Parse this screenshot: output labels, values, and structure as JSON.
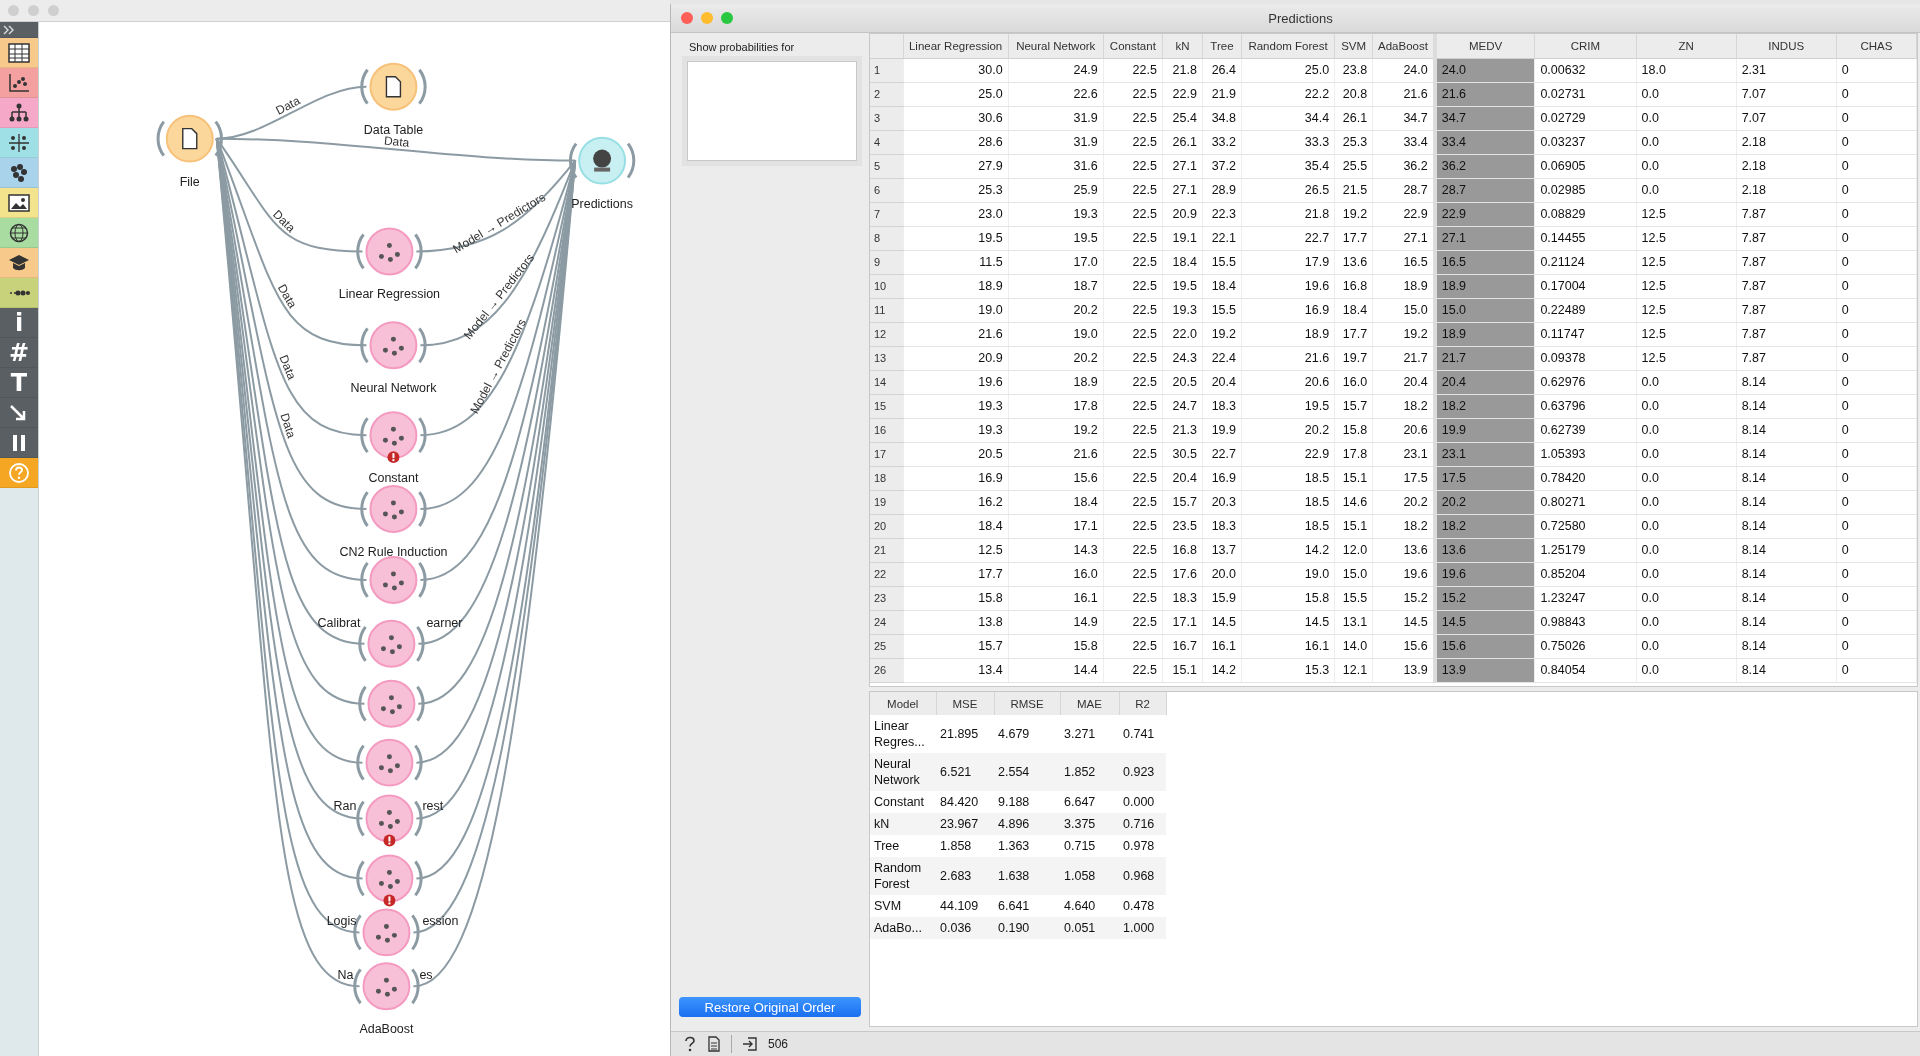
{
  "toolbar": [
    {
      "kind": "expand",
      "color": "#5a5f63"
    },
    {
      "kind": "table",
      "color": "#f7c98a"
    },
    {
      "kind": "scatter",
      "color": "#f4a0a0"
    },
    {
      "kind": "tree",
      "color": "#f5a8c8"
    },
    {
      "kind": "grid",
      "color": "#9fe0e6"
    },
    {
      "kind": "cluster",
      "color": "#a9d3ea"
    },
    {
      "kind": "image",
      "color": "#f2e38c"
    },
    {
      "kind": "globe",
      "color": "#a8dca0"
    },
    {
      "kind": "education",
      "color": "#f7c98a"
    },
    {
      "kind": "flow",
      "color": "#c8d27a"
    },
    {
      "kind": "glyph",
      "text": "i",
      "color": "#5a5f63"
    },
    {
      "kind": "glyph",
      "text": "#",
      "color": "#5a5f63"
    },
    {
      "kind": "glyph",
      "text": "T",
      "color": "#5a5f63"
    },
    {
      "kind": "arrow",
      "color": "#5a5f63"
    },
    {
      "kind": "pause",
      "color": "#5a5f63"
    },
    {
      "kind": "help",
      "color": "#f5a623"
    }
  ],
  "workflow": {
    "nodes": [
      {
        "kind": "data",
        "label": "File",
        "warning": false
      },
      {
        "kind": "data",
        "label": "Data Table",
        "warning": false,
        "in_label": "Data"
      },
      {
        "kind": "evaluate",
        "label": "Predictions",
        "warning": false,
        "in_label": "Data"
      },
      {
        "kind": "model",
        "label": "Linear Regression",
        "warning": false,
        "in_label": "Data",
        "out_label": "Model → Predictors"
      },
      {
        "kind": "model",
        "label": "Neural Network",
        "warning": false,
        "in_label": "Data",
        "out_label": "Model → Predictors"
      },
      {
        "kind": "model",
        "label": "Constant",
        "warning": true,
        "in_label": "Data",
        "out_label": "Model → Predictors"
      },
      {
        "kind": "model",
        "label": "CN2 Rule Induction",
        "warning": false,
        "in_label": "Data"
      },
      {
        "kind": "model",
        "label_parts": [
          "Calibrat",
          "earner"
        ],
        "warning": false
      },
      {
        "kind": "model",
        "warning": false
      },
      {
        "kind": "model",
        "warning": false
      },
      {
        "kind": "model",
        "label_parts": [
          "Ran",
          "rest"
        ],
        "warning": false
      },
      {
        "kind": "model",
        "warning": true
      },
      {
        "kind": "model",
        "label_parts": [
          "Logis",
          "ession"
        ],
        "warning": true
      },
      {
        "kind": "model",
        "label_parts": [
          "Na",
          "es"
        ],
        "warning": false
      },
      {
        "kind": "model",
        "label": "AdaBoost",
        "warning": false
      }
    ]
  },
  "window": {
    "title": "Predictions"
  },
  "side_panel": {
    "label": "Show probabilities for",
    "button": "Restore Original Order"
  },
  "table": {
    "columns": [
      "Linear Regression",
      "Neural Network",
      "Constant",
      "kN",
      "Tree",
      "Random Forest",
      "SVM",
      "AdaBoost",
      "MEDV",
      "CRIM",
      "ZN",
      "INDUS",
      "CHAS"
    ],
    "rows": [
      {
        "number": "1",
        "cells": [
          "30.0",
          "24.9",
          "22.5",
          "21.8",
          "26.4",
          "25.0",
          "23.8",
          "24.0",
          "24.0",
          "0.00632",
          "18.0",
          "2.31",
          "0"
        ]
      },
      {
        "number": "2",
        "cells": [
          "25.0",
          "22.6",
          "22.5",
          "22.9",
          "21.9",
          "22.2",
          "20.8",
          "21.6",
          "21.6",
          "0.02731",
          "0.0",
          "7.07",
          "0"
        ]
      },
      {
        "number": "3",
        "cells": [
          "30.6",
          "31.9",
          "22.5",
          "25.4",
          "34.8",
          "34.4",
          "26.1",
          "34.7",
          "34.7",
          "0.02729",
          "0.0",
          "7.07",
          "0"
        ]
      },
      {
        "number": "4",
        "cells": [
          "28.6",
          "31.9",
          "22.5",
          "26.1",
          "33.2",
          "33.3",
          "25.3",
          "33.4",
          "33.4",
          "0.03237",
          "0.0",
          "2.18",
          "0"
        ]
      },
      {
        "number": "5",
        "cells": [
          "27.9",
          "31.6",
          "22.5",
          "27.1",
          "37.2",
          "35.4",
          "25.5",
          "36.2",
          "36.2",
          "0.06905",
          "0.0",
          "2.18",
          "0"
        ]
      },
      {
        "number": "6",
        "cells": [
          "25.3",
          "25.9",
          "22.5",
          "27.1",
          "28.9",
          "26.5",
          "21.5",
          "28.7",
          "28.7",
          "0.02985",
          "0.0",
          "2.18",
          "0"
        ]
      },
      {
        "number": "7",
        "cells": [
          "23.0",
          "19.3",
          "22.5",
          "20.9",
          "22.3",
          "21.8",
          "19.2",
          "22.9",
          "22.9",
          "0.08829",
          "12.5",
          "7.87",
          "0"
        ]
      },
      {
        "number": "8",
        "cells": [
          "19.5",
          "19.5",
          "22.5",
          "19.1",
          "22.1",
          "22.7",
          "17.7",
          "27.1",
          "27.1",
          "0.14455",
          "12.5",
          "7.87",
          "0"
        ]
      },
      {
        "number": "9",
        "cells": [
          "11.5",
          "17.0",
          "22.5",
          "18.4",
          "15.5",
          "17.9",
          "13.6",
          "16.5",
          "16.5",
          "0.21124",
          "12.5",
          "7.87",
          "0"
        ]
      },
      {
        "number": "10",
        "cells": [
          "18.9",
          "18.7",
          "22.5",
          "19.5",
          "18.4",
          "19.6",
          "16.8",
          "18.9",
          "18.9",
          "0.17004",
          "12.5",
          "7.87",
          "0"
        ]
      },
      {
        "number": "11",
        "cells": [
          "19.0",
          "20.2",
          "22.5",
          "19.3",
          "15.5",
          "16.9",
          "18.4",
          "15.0",
          "15.0",
          "0.22489",
          "12.5",
          "7.87",
          "0"
        ]
      },
      {
        "number": "12",
        "cells": [
          "21.6",
          "19.0",
          "22.5",
          "22.0",
          "19.2",
          "18.9",
          "17.7",
          "19.2",
          "18.9",
          "0.11747",
          "12.5",
          "7.87",
          "0"
        ]
      },
      {
        "number": "13",
        "cells": [
          "20.9",
          "20.2",
          "22.5",
          "24.3",
          "22.4",
          "21.6",
          "19.7",
          "21.7",
          "21.7",
          "0.09378",
          "12.5",
          "7.87",
          "0"
        ]
      },
      {
        "number": "14",
        "cells": [
          "19.6",
          "18.9",
          "22.5",
          "20.5",
          "20.4",
          "20.6",
          "16.0",
          "20.4",
          "20.4",
          "0.62976",
          "0.0",
          "8.14",
          "0"
        ]
      },
      {
        "number": "15",
        "cells": [
          "19.3",
          "17.8",
          "22.5",
          "24.7",
          "18.3",
          "19.5",
          "15.7",
          "18.2",
          "18.2",
          "0.63796",
          "0.0",
          "8.14",
          "0"
        ]
      },
      {
        "number": "16",
        "cells": [
          "19.3",
          "19.2",
          "22.5",
          "21.3",
          "19.9",
          "20.2",
          "15.8",
          "20.6",
          "19.9",
          "0.62739",
          "0.0",
          "8.14",
          "0"
        ]
      },
      {
        "number": "17",
        "cells": [
          "20.5",
          "21.6",
          "22.5",
          "30.5",
          "22.7",
          "22.9",
          "17.8",
          "23.1",
          "23.1",
          "1.05393",
          "0.0",
          "8.14",
          "0"
        ]
      },
      {
        "number": "18",
        "cells": [
          "16.9",
          "15.6",
          "22.5",
          "20.4",
          "16.9",
          "18.5",
          "15.1",
          "17.5",
          "17.5",
          "0.78420",
          "0.0",
          "8.14",
          "0"
        ]
      },
      {
        "number": "19",
        "cells": [
          "16.2",
          "18.4",
          "22.5",
          "15.7",
          "20.3",
          "18.5",
          "14.6",
          "20.2",
          "20.2",
          "0.80271",
          "0.0",
          "8.14",
          "0"
        ]
      },
      {
        "number": "20",
        "cells": [
          "18.4",
          "17.1",
          "22.5",
          "23.5",
          "18.3",
          "18.5",
          "15.1",
          "18.2",
          "18.2",
          "0.72580",
          "0.0",
          "8.14",
          "0"
        ]
      },
      {
        "number": "21",
        "cells": [
          "12.5",
          "14.3",
          "22.5",
          "16.8",
          "13.7",
          "14.2",
          "12.0",
          "13.6",
          "13.6",
          "1.25179",
          "0.0",
          "8.14",
          "0"
        ]
      },
      {
        "number": "22",
        "cells": [
          "17.7",
          "16.0",
          "22.5",
          "17.6",
          "20.0",
          "19.0",
          "15.0",
          "19.6",
          "19.6",
          "0.85204",
          "0.0",
          "8.14",
          "0"
        ]
      },
      {
        "number": "23",
        "cells": [
          "15.8",
          "16.1",
          "22.5",
          "18.3",
          "15.9",
          "15.8",
          "15.5",
          "15.2",
          "15.2",
          "1.23247",
          "0.0",
          "8.14",
          "0"
        ]
      },
      {
        "number": "24",
        "cells": [
          "13.8",
          "14.9",
          "22.5",
          "17.1",
          "14.5",
          "14.5",
          "13.1",
          "14.5",
          "14.5",
          "0.98843",
          "0.0",
          "8.14",
          "0"
        ]
      },
      {
        "number": "25",
        "cells": [
          "15.7",
          "15.8",
          "22.5",
          "16.7",
          "16.1",
          "16.1",
          "14.0",
          "15.6",
          "15.6",
          "0.75026",
          "0.0",
          "8.14",
          "0"
        ]
      },
      {
        "number": "26",
        "cells": [
          "13.4",
          "14.4",
          "22.5",
          "15.1",
          "14.2",
          "15.3",
          "12.1",
          "13.9",
          "13.9",
          "0.84054",
          "0.0",
          "8.14",
          "0"
        ]
      }
    ]
  },
  "scores": {
    "columns": [
      "Model",
      "MSE",
      "RMSE",
      "MAE",
      "R2"
    ],
    "rows": [
      [
        "Linear Regres...",
        "21.895",
        "4.679",
        "3.271",
        "0.741"
      ],
      [
        "Neural Network",
        "6.521",
        "2.554",
        "1.852",
        "0.923"
      ],
      [
        "Constant",
        "84.420",
        "9.188",
        "6.647",
        "0.000"
      ],
      [
        "kN",
        "23.967",
        "4.896",
        "3.375",
        "0.716"
      ],
      [
        "Tree",
        "1.858",
        "1.363",
        "0.715",
        "0.978"
      ],
      [
        "Random Forest",
        "2.683",
        "1.638",
        "1.058",
        "0.968"
      ],
      [
        "SVM",
        "44.109",
        "6.641",
        "4.640",
        "0.478"
      ],
      [
        "AdaBo...",
        "0.036",
        "0.190",
        "0.051",
        "1.000"
      ]
    ]
  },
  "status_bar": {
    "count": "506"
  }
}
